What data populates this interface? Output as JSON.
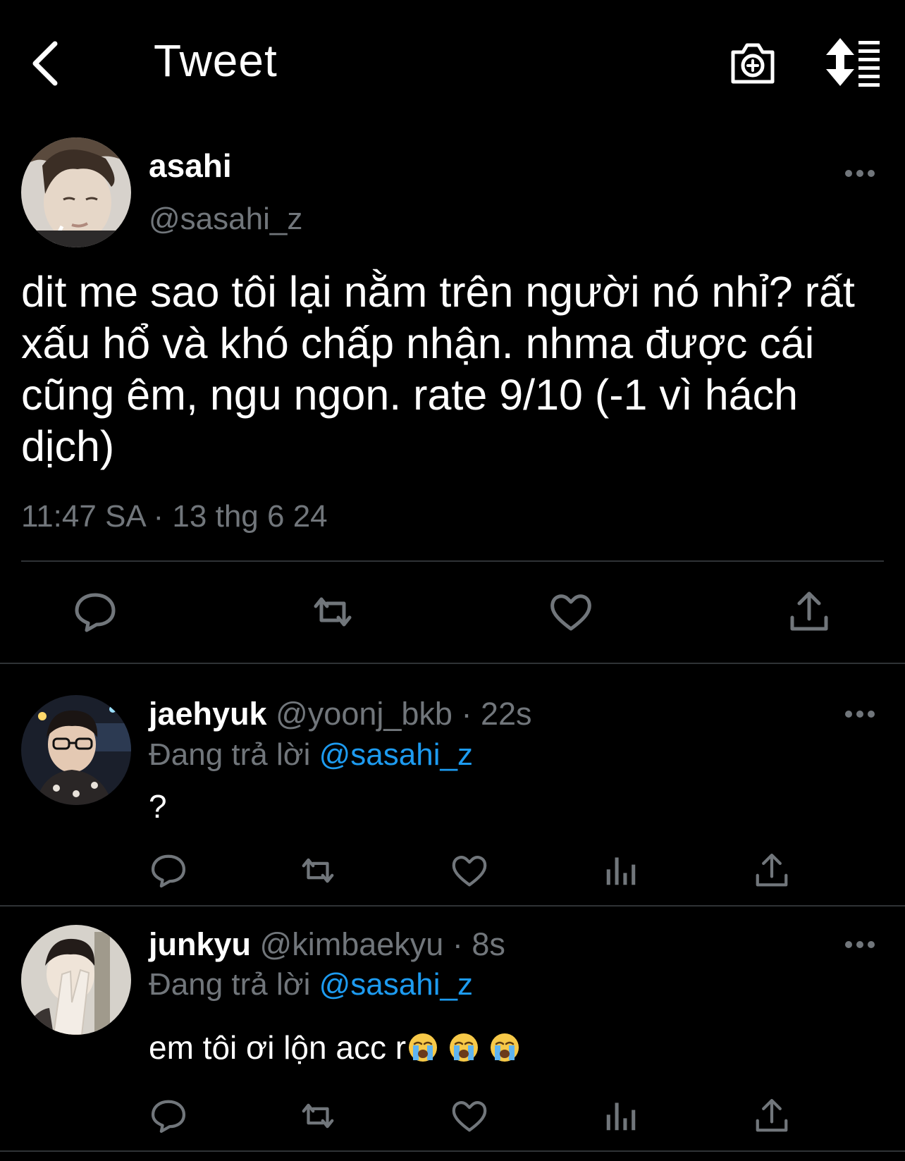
{
  "header": {
    "title": "Tweet",
    "icons": [
      "back-arrow-icon",
      "camera-plus-icon",
      "sort-list-icon"
    ]
  },
  "main_tweet": {
    "author_name": "asahi",
    "author_handle": "@sasahi_z",
    "text": "dit me sao tôi lại nằm trên người nó nhỉ? rất xấu hổ và khó chấp nhận. nhma được cái cũng êm, ngu ngon. rate 9/10 (-1 vì hách dịch)",
    "meta": "11:47 SA · 13 thg 6 24",
    "actions": [
      "reply-icon",
      "retweet-icon",
      "like-icon",
      "share-icon"
    ]
  },
  "replies": [
    {
      "name": "jaehyuk",
      "handle": "@yoonj_bkb",
      "time": "· 22s",
      "replying_label": "Đang trả lời",
      "replying_to": "@sasahi_z",
      "text": "?",
      "emoji_count": 0
    },
    {
      "name": "junkyu",
      "handle": "@kimbaekyu",
      "time": "· 8s",
      "replying_label": "Đang trả lời",
      "replying_to": "@sasahi_z",
      "text": "em tôi ơi lộn acc r",
      "emoji": "loudly-crying-face",
      "emoji_count": 3
    }
  ],
  "colors": {
    "background": "#000000",
    "text": "#ffffff",
    "muted": "#71767b",
    "link": "#1d9bf0",
    "divider": "#2f3336"
  }
}
